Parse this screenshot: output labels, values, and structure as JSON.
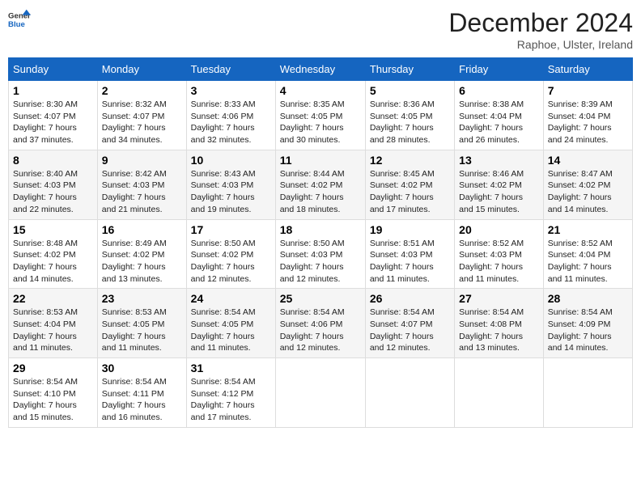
{
  "header": {
    "logo_general": "General",
    "logo_blue": "Blue",
    "month_title": "December 2024",
    "location": "Raphoe, Ulster, Ireland"
  },
  "days_of_week": [
    "Sunday",
    "Monday",
    "Tuesday",
    "Wednesday",
    "Thursday",
    "Friday",
    "Saturday"
  ],
  "weeks": [
    [
      {
        "day": "1",
        "sunrise": "8:30 AM",
        "sunset": "4:07 PM",
        "daylight": "7 hours and 37 minutes."
      },
      {
        "day": "2",
        "sunrise": "8:32 AM",
        "sunset": "4:07 PM",
        "daylight": "7 hours and 34 minutes."
      },
      {
        "day": "3",
        "sunrise": "8:33 AM",
        "sunset": "4:06 PM",
        "daylight": "7 hours and 32 minutes."
      },
      {
        "day": "4",
        "sunrise": "8:35 AM",
        "sunset": "4:05 PM",
        "daylight": "7 hours and 30 minutes."
      },
      {
        "day": "5",
        "sunrise": "8:36 AM",
        "sunset": "4:05 PM",
        "daylight": "7 hours and 28 minutes."
      },
      {
        "day": "6",
        "sunrise": "8:38 AM",
        "sunset": "4:04 PM",
        "daylight": "7 hours and 26 minutes."
      },
      {
        "day": "7",
        "sunrise": "8:39 AM",
        "sunset": "4:04 PM",
        "daylight": "7 hours and 24 minutes."
      }
    ],
    [
      {
        "day": "8",
        "sunrise": "8:40 AM",
        "sunset": "4:03 PM",
        "daylight": "7 hours and 22 minutes."
      },
      {
        "day": "9",
        "sunrise": "8:42 AM",
        "sunset": "4:03 PM",
        "daylight": "7 hours and 21 minutes."
      },
      {
        "day": "10",
        "sunrise": "8:43 AM",
        "sunset": "4:03 PM",
        "daylight": "7 hours and 19 minutes."
      },
      {
        "day": "11",
        "sunrise": "8:44 AM",
        "sunset": "4:02 PM",
        "daylight": "7 hours and 18 minutes."
      },
      {
        "day": "12",
        "sunrise": "8:45 AM",
        "sunset": "4:02 PM",
        "daylight": "7 hours and 17 minutes."
      },
      {
        "day": "13",
        "sunrise": "8:46 AM",
        "sunset": "4:02 PM",
        "daylight": "7 hours and 15 minutes."
      },
      {
        "day": "14",
        "sunrise": "8:47 AM",
        "sunset": "4:02 PM",
        "daylight": "7 hours and 14 minutes."
      }
    ],
    [
      {
        "day": "15",
        "sunrise": "8:48 AM",
        "sunset": "4:02 PM",
        "daylight": "7 hours and 14 minutes."
      },
      {
        "day": "16",
        "sunrise": "8:49 AM",
        "sunset": "4:02 PM",
        "daylight": "7 hours and 13 minutes."
      },
      {
        "day": "17",
        "sunrise": "8:50 AM",
        "sunset": "4:02 PM",
        "daylight": "7 hours and 12 minutes."
      },
      {
        "day": "18",
        "sunrise": "8:50 AM",
        "sunset": "4:03 PM",
        "daylight": "7 hours and 12 minutes."
      },
      {
        "day": "19",
        "sunrise": "8:51 AM",
        "sunset": "4:03 PM",
        "daylight": "7 hours and 11 minutes."
      },
      {
        "day": "20",
        "sunrise": "8:52 AM",
        "sunset": "4:03 PM",
        "daylight": "7 hours and 11 minutes."
      },
      {
        "day": "21",
        "sunrise": "8:52 AM",
        "sunset": "4:04 PM",
        "daylight": "7 hours and 11 minutes."
      }
    ],
    [
      {
        "day": "22",
        "sunrise": "8:53 AM",
        "sunset": "4:04 PM",
        "daylight": "7 hours and 11 minutes."
      },
      {
        "day": "23",
        "sunrise": "8:53 AM",
        "sunset": "4:05 PM",
        "daylight": "7 hours and 11 minutes."
      },
      {
        "day": "24",
        "sunrise": "8:54 AM",
        "sunset": "4:05 PM",
        "daylight": "7 hours and 11 minutes."
      },
      {
        "day": "25",
        "sunrise": "8:54 AM",
        "sunset": "4:06 PM",
        "daylight": "7 hours and 12 minutes."
      },
      {
        "day": "26",
        "sunrise": "8:54 AM",
        "sunset": "4:07 PM",
        "daylight": "7 hours and 12 minutes."
      },
      {
        "day": "27",
        "sunrise": "8:54 AM",
        "sunset": "4:08 PM",
        "daylight": "7 hours and 13 minutes."
      },
      {
        "day": "28",
        "sunrise": "8:54 AM",
        "sunset": "4:09 PM",
        "daylight": "7 hours and 14 minutes."
      }
    ],
    [
      {
        "day": "29",
        "sunrise": "8:54 AM",
        "sunset": "4:10 PM",
        "daylight": "7 hours and 15 minutes."
      },
      {
        "day": "30",
        "sunrise": "8:54 AM",
        "sunset": "4:11 PM",
        "daylight": "7 hours and 16 minutes."
      },
      {
        "day": "31",
        "sunrise": "8:54 AM",
        "sunset": "4:12 PM",
        "daylight": "7 hours and 17 minutes."
      },
      null,
      null,
      null,
      null
    ]
  ],
  "labels": {
    "sunrise": "Sunrise:",
    "sunset": "Sunset:",
    "daylight": "Daylight:"
  }
}
